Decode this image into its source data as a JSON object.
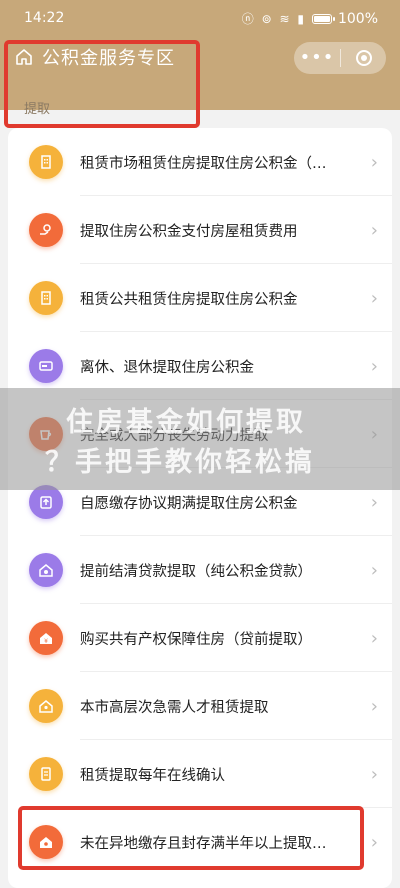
{
  "status_bar": {
    "time": "14:22",
    "battery": "100%",
    "icons": "ⓝ ⊚ ≋ ▮"
  },
  "header": {
    "title": "公积金服务专区",
    "more": "•••"
  },
  "section": {
    "label": "提取"
  },
  "items": [
    {
      "label": "租赁市场租赁住房提取住房公积金（…",
      "icon": "building-icon",
      "color": "#f5b23b"
    },
    {
      "label": "提取住房公积金支付房屋租赁费用",
      "icon": "hand-key-icon",
      "color": "#f26b3a"
    },
    {
      "label": "租赁公共租赁住房提取住房公积金",
      "icon": "building-icon",
      "color": "#f5b23b"
    },
    {
      "label": "离休、退休提取住房公积金",
      "icon": "card-icon",
      "color": "#9b7be8"
    },
    {
      "label": "完全或大部分丧失劳动力提取",
      "icon": "cup-icon",
      "color": "#f26b3a"
    },
    {
      "label": "自愿缴存协议期满提取住房公积金",
      "icon": "upload-icon",
      "color": "#9b7be8"
    },
    {
      "label": "提前结清贷款提取（纯公积金贷款）",
      "icon": "house-money-icon",
      "color": "#9b7be8"
    },
    {
      "label": "购买共有产权保障住房（贷前提取）",
      "icon": "house-yuan-icon",
      "color": "#f26b3a"
    },
    {
      "label": "本市高层次急需人才租赁提取",
      "icon": "house-user-icon",
      "color": "#f5b23b"
    },
    {
      "label": "租赁提取每年在线确认",
      "icon": "document-icon",
      "color": "#f5b23b"
    },
    {
      "label": "未在异地缴存且封存满半年以上提取…",
      "icon": "house-person-icon",
      "color": "#f26b3a"
    }
  ],
  "watermark": {
    "line1": "住房基金如何提取",
    "line2": "？手把手教你轻松搞"
  }
}
